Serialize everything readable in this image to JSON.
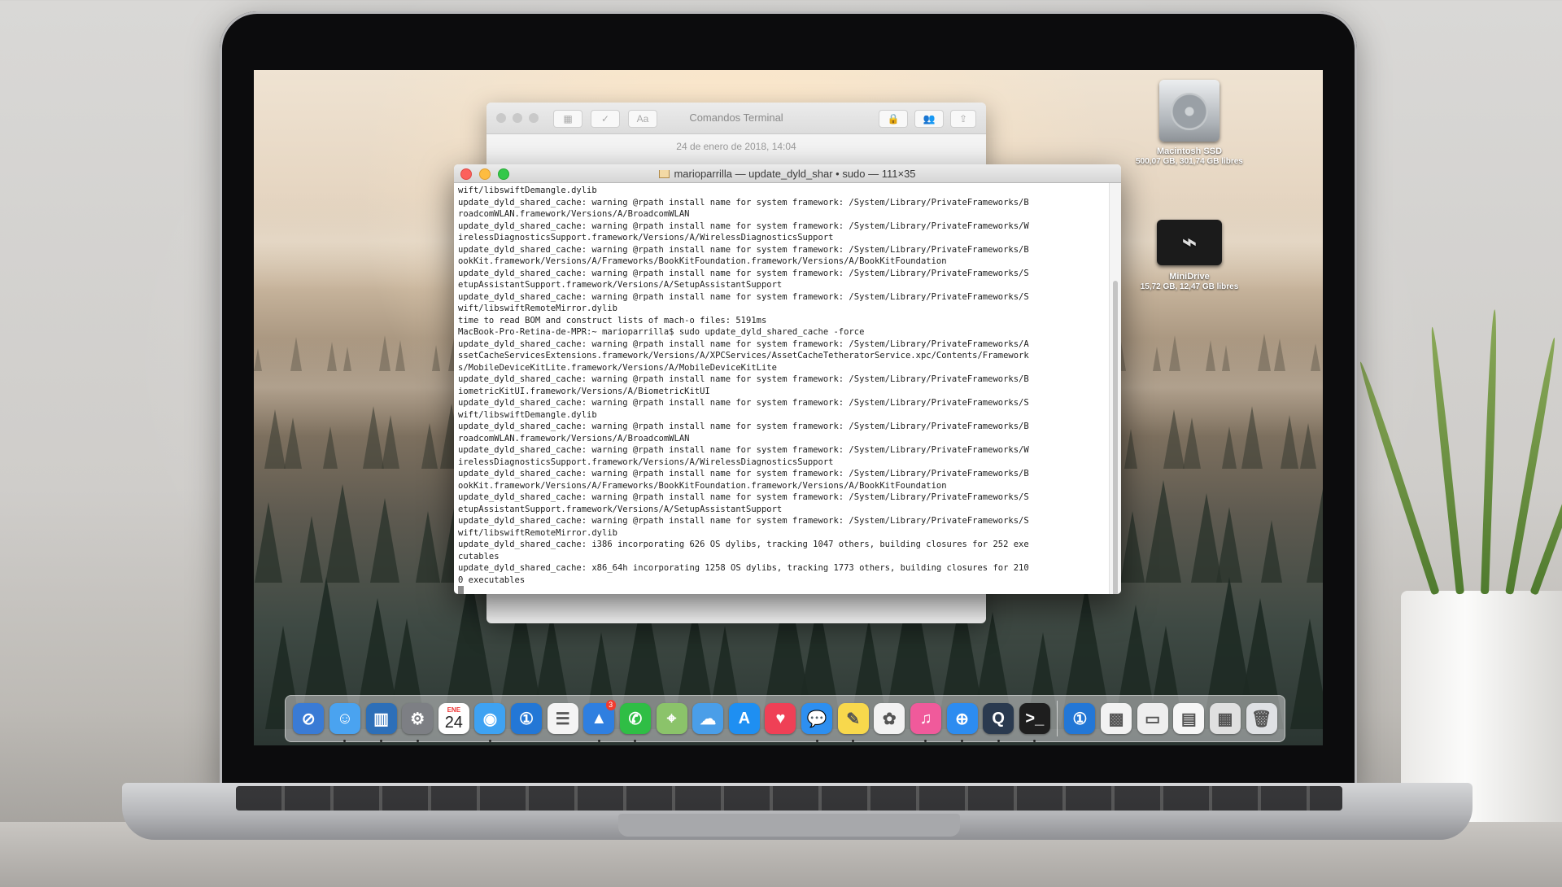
{
  "notes_window": {
    "title": "Comandos Terminal",
    "date": "24 de enero de 2018, 14:04",
    "toolbar": {
      "table": "▦",
      "checklist": "✓",
      "format": "Aa",
      "lock": "🔒",
      "share_people": "👥",
      "share": "⇪"
    }
  },
  "terminal": {
    "title": "marioparrilla — update_dyld_shar • sudo — 111×35",
    "lines": [
      "wift/libswiftDemangle.dylib",
      "update_dyld_shared_cache: warning @rpath install name for system framework: /System/Library/PrivateFrameworks/B",
      "roadcomWLAN.framework/Versions/A/BroadcomWLAN",
      "update_dyld_shared_cache: warning @rpath install name for system framework: /System/Library/PrivateFrameworks/W",
      "irelessDiagnosticsSupport.framework/Versions/A/WirelessDiagnosticsSupport",
      "update_dyld_shared_cache: warning @rpath install name for system framework: /System/Library/PrivateFrameworks/B",
      "ookKit.framework/Versions/A/Frameworks/BookKitFoundation.framework/Versions/A/BookKitFoundation",
      "update_dyld_shared_cache: warning @rpath install name for system framework: /System/Library/PrivateFrameworks/S",
      "etupAssistantSupport.framework/Versions/A/SetupAssistantSupport",
      "update_dyld_shared_cache: warning @rpath install name for system framework: /System/Library/PrivateFrameworks/S",
      "wift/libswiftRemoteMirror.dylib",
      "time to read BOM and construct lists of mach-o files: 5191ms",
      "MacBook-Pro-Retina-de-MPR:~ marioparrilla$ sudo update_dyld_shared_cache -force",
      "update_dyld_shared_cache: warning @rpath install name for system framework: /System/Library/PrivateFrameworks/A",
      "ssetCacheServicesExtensions.framework/Versions/A/XPCServices/AssetCacheTetheratorService.xpc/Contents/Framework",
      "s/MobileDeviceKitLite.framework/Versions/A/MobileDeviceKitLite",
      "update_dyld_shared_cache: warning @rpath install name for system framework: /System/Library/PrivateFrameworks/B",
      "iometricKitUI.framework/Versions/A/BiometricKitUI",
      "update_dyld_shared_cache: warning @rpath install name for system framework: /System/Library/PrivateFrameworks/S",
      "wift/libswiftDemangle.dylib",
      "update_dyld_shared_cache: warning @rpath install name for system framework: /System/Library/PrivateFrameworks/B",
      "roadcomWLAN.framework/Versions/A/BroadcomWLAN",
      "update_dyld_shared_cache: warning @rpath install name for system framework: /System/Library/PrivateFrameworks/W",
      "irelessDiagnosticsSupport.framework/Versions/A/WirelessDiagnosticsSupport",
      "update_dyld_shared_cache: warning @rpath install name for system framework: /System/Library/PrivateFrameworks/B",
      "ookKit.framework/Versions/A/Frameworks/BookKitFoundation.framework/Versions/A/BookKitFoundation",
      "update_dyld_shared_cache: warning @rpath install name for system framework: /System/Library/PrivateFrameworks/S",
      "etupAssistantSupport.framework/Versions/A/SetupAssistantSupport",
      "update_dyld_shared_cache: warning @rpath install name for system framework: /System/Library/PrivateFrameworks/S",
      "wift/libswiftRemoteMirror.dylib",
      "update_dyld_shared_cache: i386 incorporating 626 OS dylibs, tracking 1047 others, building closures for 252 exe",
      "cutables",
      "update_dyld_shared_cache: x86_64h incorporating 1258 OS dylibs, tracking 1773 others, building closures for 210",
      "0 executables"
    ]
  },
  "desktop_icons": [
    {
      "name": "Macintosh SSD",
      "info": "500,07 GB, 301,74 GB libres"
    },
    {
      "name": "MiniDrive",
      "info": "15,72 GB, 12,47 GB libres"
    }
  ],
  "dock": {
    "items": [
      {
        "name": "safari-stopwatch-icon",
        "glyph": "⊘",
        "color": "#3a7bd5",
        "running": false
      },
      {
        "name": "finder-icon",
        "glyph": "☺",
        "color": "#4aa3f0",
        "running": true
      },
      {
        "name": "istat-icon",
        "glyph": "▥",
        "color": "#2d6fb8",
        "running": true
      },
      {
        "name": "system-preferences-icon",
        "glyph": "⚙",
        "color": "#7d7f84",
        "running": true
      },
      {
        "name": "calendar-icon",
        "glyph": "24",
        "month": "ENE",
        "color": "#ffffff",
        "running": false
      },
      {
        "name": "tweetbot-icon",
        "glyph": "◉",
        "color": "#3ea2f2",
        "running": true
      },
      {
        "name": "1password-icon",
        "glyph": "①",
        "color": "#2377d6",
        "running": false
      },
      {
        "name": "reminders-icon",
        "glyph": "☰",
        "color": "#f4f4f4",
        "running": false
      },
      {
        "name": "spark-mail-icon",
        "glyph": "▲",
        "color": "#2f7fe0",
        "running": true,
        "badge": "3"
      },
      {
        "name": "whatsapp-icon",
        "glyph": "✆",
        "color": "#2fbe45",
        "running": true
      },
      {
        "name": "maps-icon",
        "glyph": "⌖",
        "color": "#8bc36a",
        "running": false
      },
      {
        "name": "icloud-drive-icon",
        "glyph": "☁",
        "color": "#4a9ee8",
        "running": false
      },
      {
        "name": "app-store-icon",
        "glyph": "A",
        "color": "#1e8ff2",
        "running": false
      },
      {
        "name": "pocket-icon",
        "glyph": "♥",
        "color": "#ef4056",
        "running": false
      },
      {
        "name": "messages-icon",
        "glyph": "💬",
        "color": "#2d8ff0",
        "running": true
      },
      {
        "name": "notes-icon",
        "glyph": "✎",
        "color": "#f8d84c",
        "running": true
      },
      {
        "name": "photos-icon",
        "glyph": "✿",
        "color": "#f2f2f2",
        "running": false
      },
      {
        "name": "itunes-icon",
        "glyph": "♫",
        "color": "#f05a9b",
        "running": true
      },
      {
        "name": "safari-icon",
        "glyph": "⊕",
        "color": "#2d8cf0",
        "running": true
      },
      {
        "name": "quicktime-icon",
        "glyph": "Q",
        "color": "#2a3a4f",
        "running": true
      },
      {
        "name": "terminal-icon",
        "glyph": ">_",
        "color": "#1e1e1e",
        "running": true
      }
    ],
    "right_items": [
      {
        "name": "1password-mini-icon",
        "glyph": "①",
        "color": "#2377d6"
      },
      {
        "name": "qr-code-icon",
        "glyph": "▩",
        "color": "#f2f2f2"
      },
      {
        "name": "scanner-icon",
        "glyph": "▭",
        "color": "#eeeeee"
      },
      {
        "name": "document-icon",
        "glyph": "▤",
        "color": "#f6f6f6"
      },
      {
        "name": "downloads-stack-icon",
        "glyph": "▦",
        "color": "#e0e0e0"
      },
      {
        "name": "trash-icon",
        "glyph": "🗑",
        "color": "#dfe1e4"
      }
    ]
  }
}
